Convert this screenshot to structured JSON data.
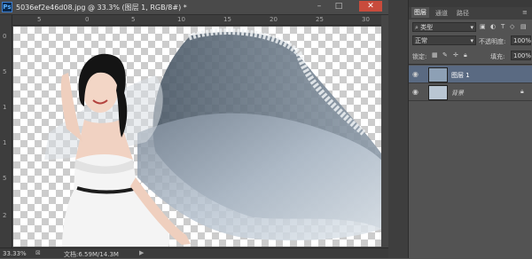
{
  "document": {
    "icon": "Ps",
    "title": "5036ef2e46d08.jpg @ 33.3% (图层 1, RGB/8#) *",
    "ruler_top_labels": [
      "5",
      "0",
      "5",
      "10",
      "15",
      "20",
      "25",
      "30"
    ],
    "ruler_left_labels": [
      "0",
      "5",
      "1",
      "1",
      "5",
      "2"
    ]
  },
  "window_controls": {
    "minimize": "–",
    "restore": "□",
    "close": "✕"
  },
  "status_bar": {
    "zoom": "33.33%",
    "doc_info": "文档:6.59M/14.3M"
  },
  "panel": {
    "tabs": [
      "图层",
      "通道",
      "路径"
    ],
    "kind_filter": "类型",
    "blend_mode": "正常",
    "opacity_label": "不透明度:",
    "opacity_value": "100%",
    "lock_label": "锁定:",
    "fill_label": "填充:",
    "fill_value": "100%",
    "layers": [
      {
        "name": "图层 1",
        "selected": true
      },
      {
        "name": "背景",
        "selected": false
      }
    ]
  },
  "colors": {
    "selected_layer": "#5a6a82",
    "canvas_checker": "#cccccc",
    "bg_panel": "#535353"
  }
}
